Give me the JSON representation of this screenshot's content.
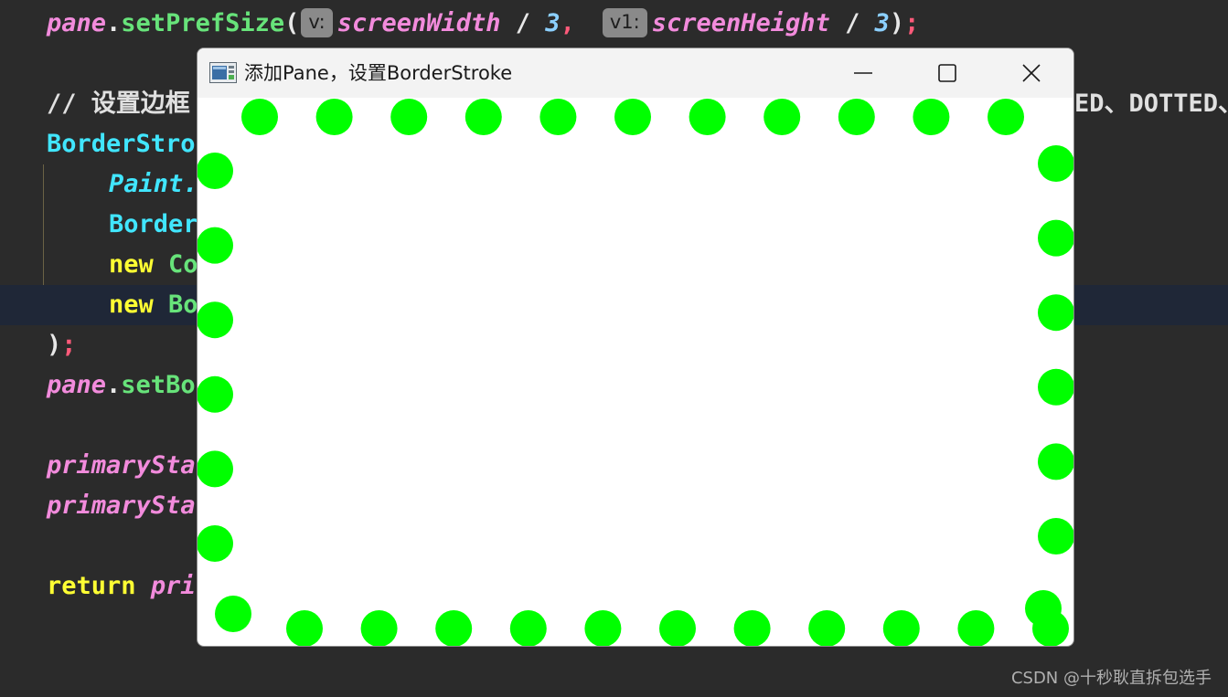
{
  "editor": {
    "line1": {
      "t1": "pane",
      "t2": ".",
      "t3": "setPrefSize",
      "t4": "(",
      "hint1": "v:",
      "t5": "screenWidth",
      "t6": " / ",
      "t7": "3",
      "t8": ",",
      "hint2": "v1:",
      "t9": "screenHeight",
      "t10": " / ",
      "t11": "3",
      "t12": ")",
      "t13": ";"
    },
    "line2": {
      "t1": "// 设置边框",
      "t2": "ED、DOTTED、"
    },
    "line3": {
      "t1": "BorderStro"
    },
    "line4": {
      "t1": "Paint."
    },
    "line5": {
      "t1": "Border"
    },
    "line6": {
      "t1": "new",
      "t2": "Co"
    },
    "line7": {
      "t1": "new",
      "t2": "Bo"
    },
    "line8": {
      "t1": ")",
      "t2": ";"
    },
    "line9": {
      "t1": "pane",
      "t2": ".",
      "t3": "setBo"
    },
    "line10": {
      "t1": "primarySta"
    },
    "line11": {
      "t1": "primarySta"
    },
    "line12": {
      "t1": "return",
      "t2": "pri"
    }
  },
  "window": {
    "title": "添加Pane，设置BorderStroke",
    "border_color": "#00ff00",
    "border_style": "dotted"
  },
  "icons": {
    "app": "app-window-icon",
    "minimize": "minimize-icon",
    "maximize": "maximize-icon",
    "close": "close-icon"
  },
  "watermark": "CSDN @十秒耿直拆包选手"
}
